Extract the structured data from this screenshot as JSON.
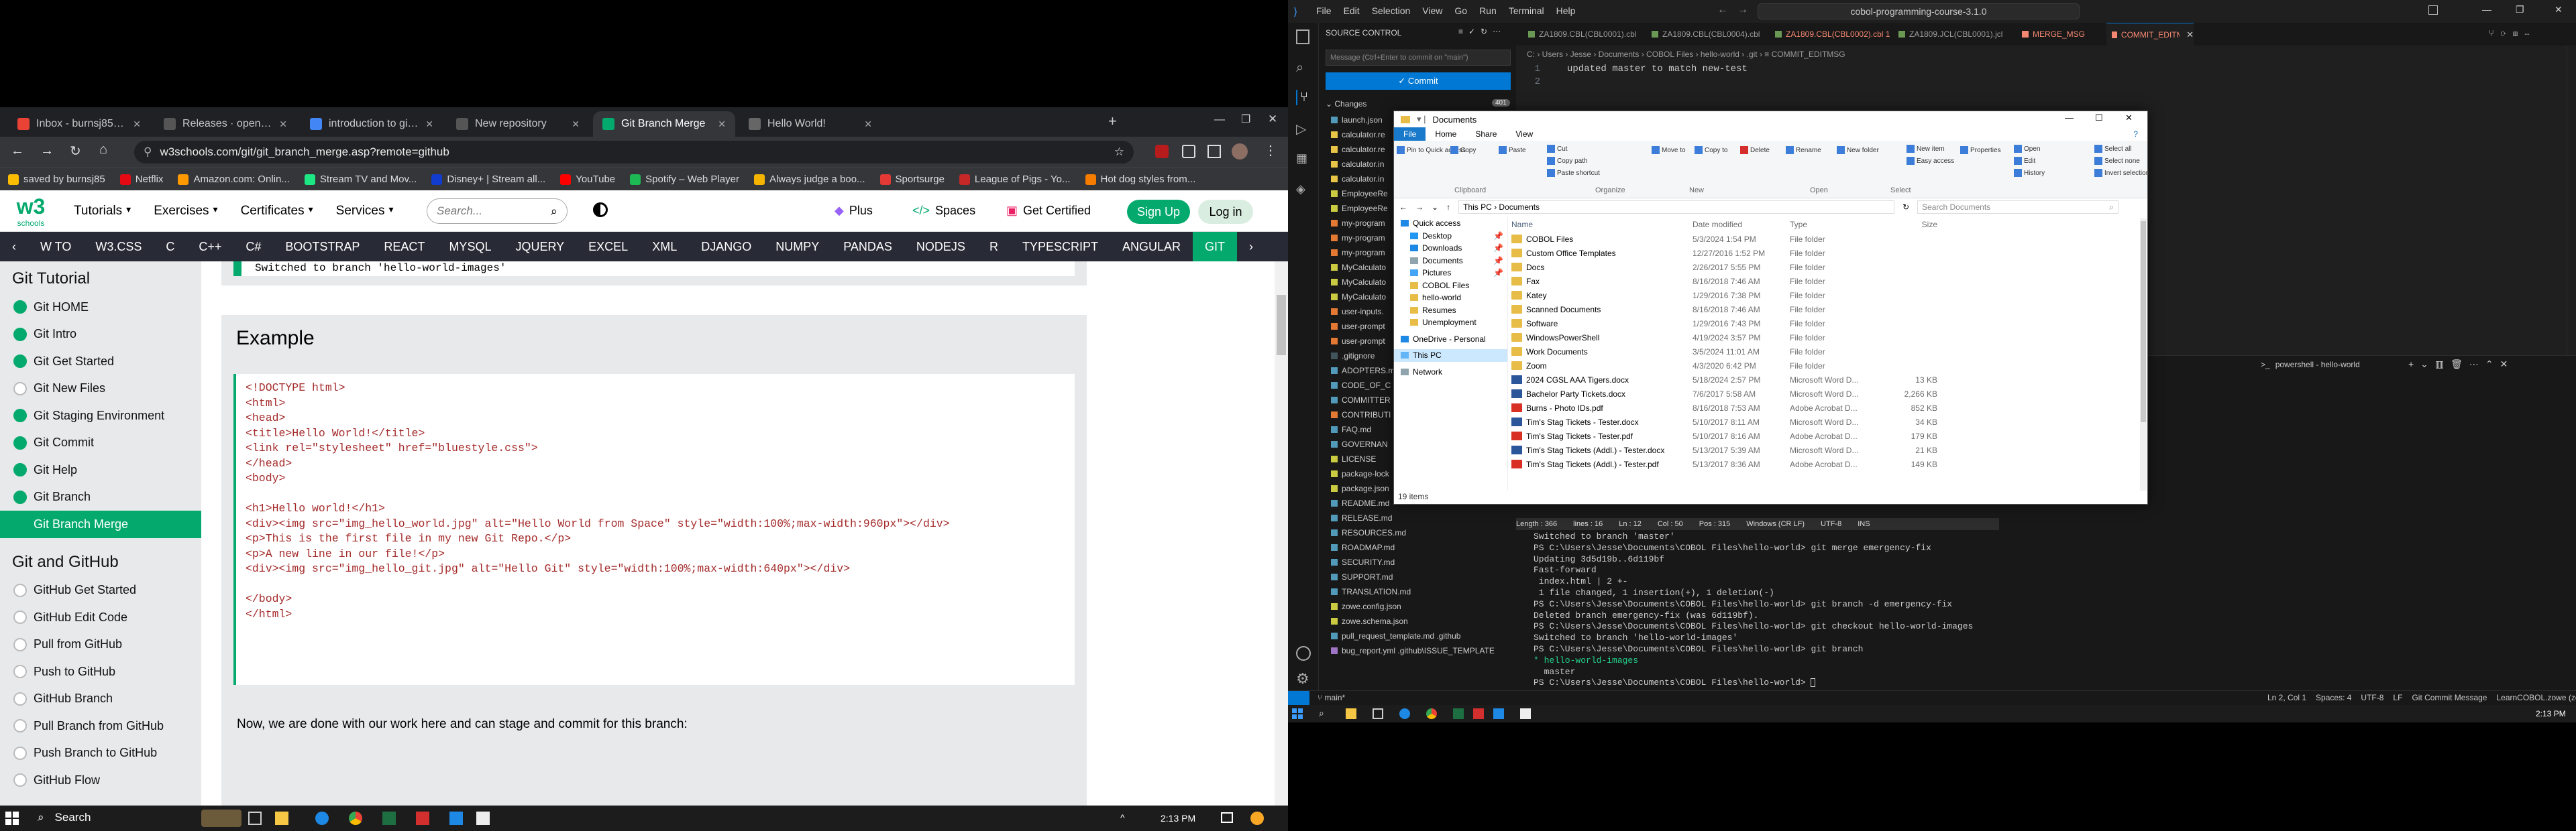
{
  "browser": {
    "tabs": [
      {
        "label": "Inbox - burnsj85@gmail.co",
        "color": "#ea4335"
      },
      {
        "label": "Releases · openmainframe",
        "color": "#555"
      },
      {
        "label": "introduction to git - Goog",
        "color": "#4285f4"
      },
      {
        "label": "New repository",
        "color": "#555"
      },
      {
        "label": "Git Branch Merge",
        "color": "#04aa6d"
      },
      {
        "label": "Hello World!",
        "color": "#666"
      }
    ],
    "url": "w3schools.com/git/git_branch_merge.asp?remote=github",
    "bookmarks": [
      "saved by burnsj85",
      "Netflix",
      "Amazon.com: Onlin...",
      "Stream TV and Mov...",
      "Disney+ | Stream all...",
      "YouTube",
      "Spotify – Web Player",
      "Always judge a boo...",
      "Sportsurge",
      "League of Pigs - Yo...",
      "Hot dog styles from..."
    ],
    "bookmark_colors": [
      "#fbbc04",
      "#e50914",
      "#ff9900",
      "#1ce783",
      "#113ccf",
      "#ff0000",
      "#1db954",
      "#f4b400",
      "#e53935",
      "#c62828",
      "#f57c00"
    ]
  },
  "w3": {
    "logo": "w3",
    "logo_sub": "schools",
    "menus": [
      "Tutorials",
      "Exercises",
      "Certificates",
      "Services"
    ],
    "search_placeholder": "Search...",
    "plus": "Plus",
    "spaces": "Spaces",
    "get_certified": "Get Certified",
    "signup": "Sign Up",
    "login": "Log in",
    "nav": [
      "W TO",
      "W3.CSS",
      "C",
      "C++",
      "C#",
      "BOOTSTRAP",
      "REACT",
      "MYSQL",
      "JQUERY",
      "EXCEL",
      "XML",
      "DJANGO",
      "NUMPY",
      "PANDAS",
      "NODEJS",
      "R",
      "TYPESCRIPT",
      "ANGULAR",
      "GIT"
    ],
    "sidebar_title": "Git Tutorial",
    "sidebar_items": [
      "Git HOME",
      "Git Intro",
      "Git Get Started",
      "Git New Files",
      "Git Staging Environment",
      "Git Commit",
      "Git Help",
      "Git Branch",
      "Git Branch Merge"
    ],
    "sidebar_title2": "Git and GitHub",
    "sidebar_items2": [
      "GitHub Get Started",
      "GitHub Edit Code",
      "Pull from GitHub",
      "Push to GitHub",
      "GitHub Branch",
      "Pull Branch from GitHub",
      "Push Branch to GitHub",
      "GitHub Flow"
    ],
    "prev_output": "Switched to branch 'hello-world-images'",
    "example_heading": "Example",
    "code_lines": [
      "<!DOCTYPE html>",
      "<html>",
      "<head>",
      "<title>Hello World!</title>",
      "<link rel=\"stylesheet\" href=\"bluestyle.css\">",
      "</head>",
      "<body>",
      "",
      "<h1>Hello world!</h1>",
      "<div><img src=\"img_hello_world.jpg\" alt=\"Hello World from Space\" style=\"width:100%;max-width:960px\"></div>",
      "<p>This is the first file in my new Git Repo.</p>",
      "<p>A new line in our file!</p>",
      "<div><img src=\"img_hello_git.jpg\" alt=\"Hello Git\" style=\"width:100%;max-width:640px\"></div>",
      "",
      "</body>",
      "</html>"
    ],
    "after_text": "Now, we are done with our work here and can stage and commit for this branch:"
  },
  "taskbar_left": {
    "search": "Search",
    "time": "2:13 PM"
  },
  "vscode": {
    "menu": [
      "File",
      "Edit",
      "Selection",
      "View",
      "Go",
      "Run",
      "Terminal",
      "Help"
    ],
    "title_search": "cobol-programming-course-3.1.0",
    "scm_title": "SOURCE CONTROL",
    "commit_placeholder": "Message (Ctrl+Enter to commit on \"main\")",
    "commit_button": "✓ Commit",
    "changes_label": "Changes",
    "changes_count": "401",
    "files": [
      "launch.json",
      "calculator.re",
      "calculator.re",
      "calculator.in",
      "calculator.in",
      "EmployeeRe",
      "EmployeeRe",
      "my-program",
      "my-program",
      "my-program",
      "MyCalculato",
      "MyCalculato",
      "MyCalculato",
      "user-inputs.",
      "user-prompt",
      "user-prompt",
      ".gitignore",
      "ADOPTERS.m",
      "CODE_OF_C",
      "COMMITTER",
      "CONTRIBUTI",
      "FAQ.md",
      "GOVERNAN",
      "LICENSE",
      "package-lock",
      "package.json",
      "README.md",
      "RELEASE.md",
      "RESOURCES.md",
      "ROADMAP.md",
      "SECURITY.md",
      "SUPPORT.md",
      "TRANSLATION.md",
      "zowe.config.json",
      "zowe.schema.json",
      "pull_request_template.md .github",
      "bug_report.yml .github\\ISSUE_TEMPLATE"
    ],
    "editor_tabs": [
      "ZA1809.CBL(CBL0001).cbl",
      "ZA1809.CBL(CBL0004).cbl",
      "ZA1809.CBL(CBL0002).cbl 1",
      "ZA1809.JCL(CBL0001).jcl",
      "MERGE_MSG",
      "COMMIT_EDITMSG"
    ],
    "breadcrumb": "C: › Users › Jesse › Documents › COBOL Files › hello-world › .git › ≡ COMMIT_EDITMSG",
    "editor_lines": [
      "updated master to match new-test",
      ""
    ],
    "terminal_tab": "powershell - hello-world",
    "terminal_lines": [
      "Switched to branch 'master'",
      "PS C:\\Users\\Jesse\\Documents\\COBOL Files\\hello-world> git merge emergency-fix",
      "Updating 3d5d19b..6d119bf",
      "Fast-forward",
      " index.html | 2 +-",
      " 1 file changed, 1 insertion(+), 1 deletion(-)",
      "PS C:\\Users\\Jesse\\Documents\\COBOL Files\\hello-world> git branch -d emergency-fix",
      "Deleted branch emergency-fix (was 6d119bf).",
      "PS C:\\Users\\Jesse\\Documents\\COBOL Files\\hello-world> git checkout hello-world-images",
      "Switched to branch 'hello-world-images'",
      "PS C:\\Users\\Jesse\\Documents\\COBOL Files\\hello-world> git branch",
      "* hello-world-images",
      "  master",
      "PS C:\\Users\\Jesse\\Documents\\COBOL Files\\hello-world> "
    ],
    "status_left": "main*",
    "status_right": [
      "Ln 2, Col 1",
      "Spaces: 4",
      "UTF-8",
      "LF",
      "Git Commit Message",
      "LearnCOBOL.zowe (zowe)"
    ],
    "editor_status": [
      "Length : 366",
      "lines : 16",
      "Ln : 12",
      "Col : 50",
      "Pos : 315",
      "Windows (CR LF)",
      "UTF-8",
      "INS"
    ],
    "time": "2:13 PM"
  },
  "explorer": {
    "title": "Documents",
    "menu": [
      "File",
      "Home",
      "Share",
      "View"
    ],
    "ribbon_groups": [
      "Clipboard",
      "Organize",
      "New",
      "Open",
      "Select"
    ],
    "ribbon_buttons": [
      "Pin to Quick access",
      "Copy",
      "Paste",
      "Cut",
      "Copy path",
      "Paste shortcut",
      "Move to",
      "Copy to",
      "Delete",
      "Rename",
      "New folder",
      "New item",
      "Easy access",
      "Properties",
      "Open",
      "Edit",
      "History",
      "Select all",
      "Select none",
      "Invert selection"
    ],
    "path": "This PC › Documents",
    "search_placeholder": "Search Documents",
    "nav": [
      "Quick access",
      "Desktop",
      "Downloads",
      "Documents",
      "Pictures",
      "COBOL Files",
      "hello-world",
      "Resumes",
      "Unemployment",
      "OneDrive - Personal",
      "This PC",
      "Network"
    ],
    "columns": [
      "Name",
      "Date modified",
      "Type",
      "Size"
    ],
    "files": [
      {
        "name": "COBOL Files",
        "date": "5/3/2024 1:54 PM",
        "type": "File folder",
        "size": "",
        "kind": "folder"
      },
      {
        "name": "Custom Office Templates",
        "date": "12/27/2016 1:52 PM",
        "type": "File folder",
        "size": "",
        "kind": "folder"
      },
      {
        "name": "Docs",
        "date": "2/26/2017 5:55 PM",
        "type": "File folder",
        "size": "",
        "kind": "folder"
      },
      {
        "name": "Fax",
        "date": "8/16/2018 7:46 AM",
        "type": "File folder",
        "size": "",
        "kind": "folder"
      },
      {
        "name": "Katey",
        "date": "1/29/2016 7:38 PM",
        "type": "File folder",
        "size": "",
        "kind": "folder"
      },
      {
        "name": "Scanned Documents",
        "date": "8/16/2018 7:46 AM",
        "type": "File folder",
        "size": "",
        "kind": "folder"
      },
      {
        "name": "Software",
        "date": "1/29/2016 7:43 PM",
        "type": "File folder",
        "size": "",
        "kind": "folder"
      },
      {
        "name": "WindowsPowerShell",
        "date": "4/19/2024 3:57 PM",
        "type": "File folder",
        "size": "",
        "kind": "folder"
      },
      {
        "name": "Work Documents",
        "date": "3/5/2024 11:01 AM",
        "type": "File folder",
        "size": "",
        "kind": "folder"
      },
      {
        "name": "Zoom",
        "date": "4/3/2020 6:42 PM",
        "type": "File folder",
        "size": "",
        "kind": "folder"
      },
      {
        "name": "2024 CGSL AAA Tigers.docx",
        "date": "5/18/2024 2:57 PM",
        "type": "Microsoft Word D...",
        "size": "13 KB",
        "kind": "doc"
      },
      {
        "name": "Bachelor Party Tickets.docx",
        "date": "7/6/2017 5:58 AM",
        "type": "Microsoft Word D...",
        "size": "2,266 KB",
        "kind": "doc"
      },
      {
        "name": "Burns - Photo IDs.pdf",
        "date": "8/16/2018 7:53 AM",
        "type": "Adobe Acrobat D...",
        "size": "852 KB",
        "kind": "pdf"
      },
      {
        "name": "Tim's Stag Tickets - Tester.docx",
        "date": "5/10/2017 8:11 AM",
        "type": "Microsoft Word D...",
        "size": "34 KB",
        "kind": "doc"
      },
      {
        "name": "Tim's Stag Tickets - Tester.pdf",
        "date": "5/10/2017 8:16 AM",
        "type": "Adobe Acrobat D...",
        "size": "179 KB",
        "kind": "pdf"
      },
      {
        "name": "Tim's Stag Tickets (Addl.) - Tester.docx",
        "date": "5/13/2017 5:39 AM",
        "type": "Microsoft Word D...",
        "size": "21 KB",
        "kind": "doc"
      },
      {
        "name": "Tim's Stag Tickets (Addl.) - Tester.pdf",
        "date": "5/13/2017 8:36 AM",
        "type": "Adobe Acrobat D...",
        "size": "149 KB",
        "kind": "pdf"
      }
    ],
    "item_count": "19 items"
  }
}
